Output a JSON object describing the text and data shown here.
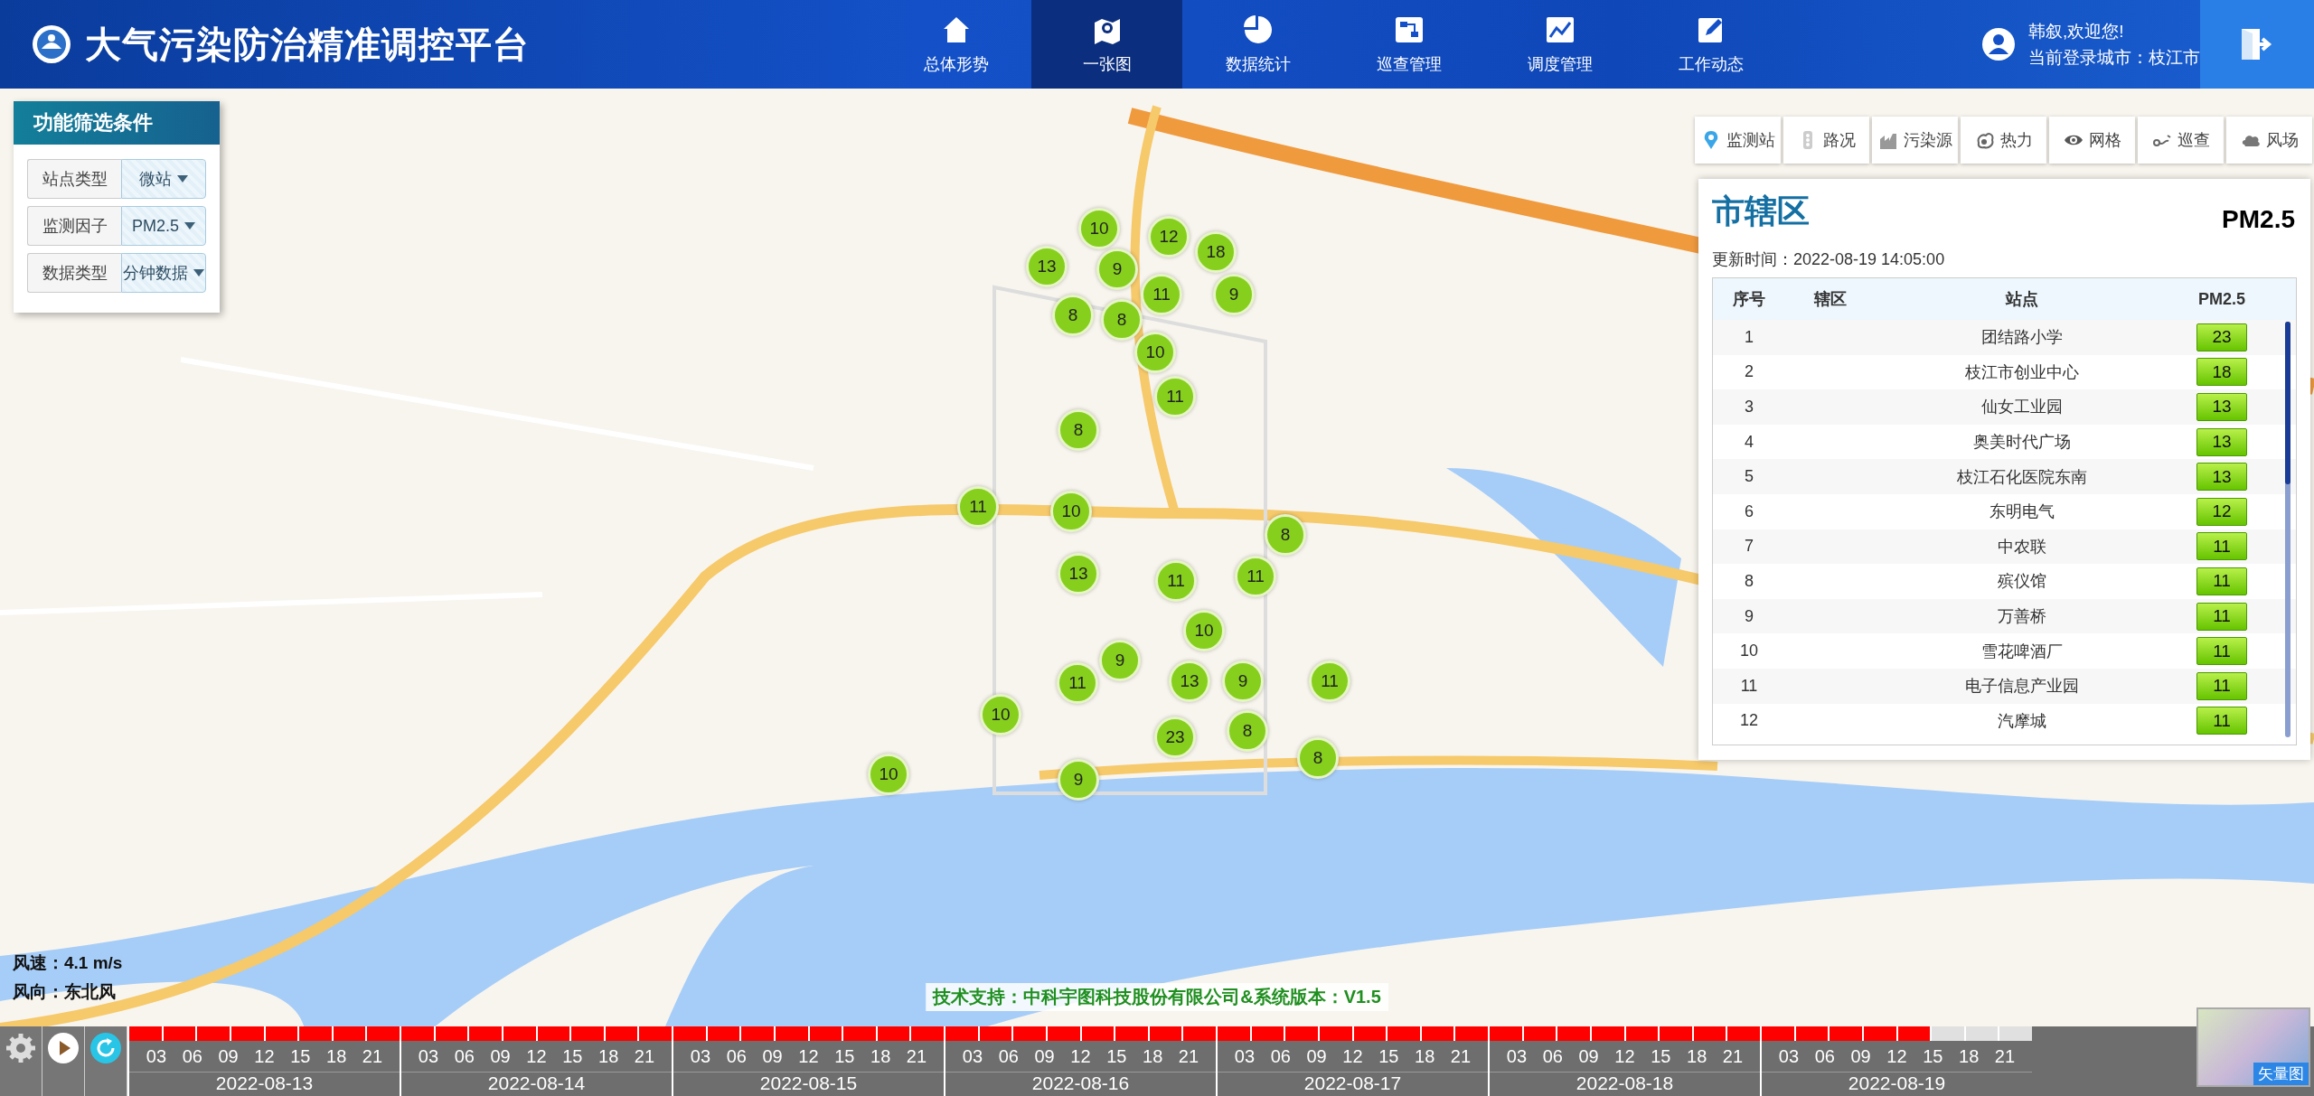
{
  "header": {
    "title": "大气污染防治精准调控平台",
    "nav": [
      {
        "label": "总体形势",
        "selected": false
      },
      {
        "label": "一张图",
        "selected": true
      },
      {
        "label": "数据统计",
        "selected": false
      },
      {
        "label": "巡查管理",
        "selected": false
      },
      {
        "label": "调度管理",
        "selected": false
      },
      {
        "label": "工作动态",
        "selected": false
      }
    ],
    "user": {
      "greeting": "韩叙,欢迎您!",
      "city": "当前登录城市：枝江市"
    }
  },
  "filters": {
    "title": "功能筛选条件",
    "rows": [
      {
        "label": "站点类型",
        "value": "微站"
      },
      {
        "label": "监测因子",
        "value": "PM2.5"
      },
      {
        "label": "数据类型",
        "value": "分钟数据"
      }
    ]
  },
  "layers": [
    {
      "label": "监测站"
    },
    {
      "label": "路况"
    },
    {
      "label": "污染源"
    },
    {
      "label": "热力"
    },
    {
      "label": "网格"
    },
    {
      "label": "巡查"
    },
    {
      "label": "风场"
    }
  ],
  "markers": [
    {
      "value": "10"
    },
    {
      "value": "12"
    },
    {
      "value": "18"
    },
    {
      "value": "13"
    },
    {
      "value": "9"
    },
    {
      "value": "11"
    },
    {
      "value": "9"
    },
    {
      "value": "8"
    },
    {
      "value": "8"
    },
    {
      "value": "10"
    },
    {
      "value": "11"
    },
    {
      "value": "8"
    },
    {
      "value": "11"
    },
    {
      "value": "10"
    },
    {
      "value": "8"
    },
    {
      "value": "13"
    },
    {
      "value": "11"
    },
    {
      "value": "11"
    },
    {
      "value": "10"
    },
    {
      "value": "9"
    },
    {
      "value": "11"
    },
    {
      "value": "13"
    },
    {
      "value": "9"
    },
    {
      "value": "11"
    },
    {
      "value": "10"
    },
    {
      "value": "23"
    },
    {
      "value": "8"
    },
    {
      "value": "10"
    },
    {
      "value": "8"
    },
    {
      "value": "9"
    }
  ],
  "panel": {
    "title": "市辖区",
    "pollutant": "PM2.5",
    "update_time": "更新时间：2022-08-19 14:05:00",
    "columns": [
      "序号",
      "辖区",
      "站点",
      "PM2.5"
    ],
    "rows": [
      {
        "index": "1",
        "station": "团结路小学",
        "value": "23"
      },
      {
        "index": "2",
        "station": "枝江市创业中心",
        "value": "18"
      },
      {
        "index": "3",
        "station": "仙女工业园",
        "value": "13"
      },
      {
        "index": "4",
        "station": "奥美时代广场",
        "value": "13"
      },
      {
        "index": "5",
        "station": "枝江石化医院东南",
        "value": "13"
      },
      {
        "index": "6",
        "station": "东明电气",
        "value": "12"
      },
      {
        "index": "7",
        "station": "中农联",
        "value": "11"
      },
      {
        "index": "8",
        "station": "殡仪馆",
        "value": "11"
      },
      {
        "index": "9",
        "station": "万善桥",
        "value": "11"
      },
      {
        "index": "10",
        "station": "雪花啤酒厂",
        "value": "11"
      },
      {
        "index": "11",
        "station": "电子信息产业园",
        "value": "11"
      },
      {
        "index": "12",
        "station": "汽摩城",
        "value": "11"
      }
    ]
  },
  "wind": {
    "speed": "风速：4.1 m/s",
    "direction": "风向：东北风"
  },
  "timeline": {
    "days": [
      {
        "date": "2022-08-13",
        "hours": [
          "03",
          "06",
          "09",
          "12",
          "15",
          "18",
          "21"
        ],
        "segments": [
          {
            "filled": true
          },
          {
            "filled": true
          },
          {
            "filled": true
          },
          {
            "filled": true
          },
          {
            "filled": true
          },
          {
            "filled": true
          },
          {
            "filled": true
          },
          {
            "filled": true
          }
        ]
      },
      {
        "date": "2022-08-14",
        "hours": [
          "03",
          "06",
          "09",
          "12",
          "15",
          "18",
          "21"
        ],
        "segments": [
          {
            "filled": true
          },
          {
            "filled": true
          },
          {
            "filled": true
          },
          {
            "filled": true
          },
          {
            "filled": true
          },
          {
            "filled": true
          },
          {
            "filled": true
          },
          {
            "filled": true
          }
        ]
      },
      {
        "date": "2022-08-15",
        "hours": [
          "03",
          "06",
          "09",
          "12",
          "15",
          "18",
          "21"
        ],
        "segments": [
          {
            "filled": true
          },
          {
            "filled": true
          },
          {
            "filled": true
          },
          {
            "filled": true
          },
          {
            "filled": true
          },
          {
            "filled": true
          },
          {
            "filled": true
          },
          {
            "filled": true
          }
        ]
      },
      {
        "date": "2022-08-16",
        "hours": [
          "03",
          "06",
          "09",
          "12",
          "15",
          "18",
          "21"
        ],
        "segments": [
          {
            "filled": true
          },
          {
            "filled": true
          },
          {
            "filled": true
          },
          {
            "filled": true
          },
          {
            "filled": true
          },
          {
            "filled": true
          },
          {
            "filled": true
          },
          {
            "filled": true
          }
        ]
      },
      {
        "date": "2022-08-17",
        "hours": [
          "03",
          "06",
          "09",
          "12",
          "15",
          "18",
          "21"
        ],
        "segments": [
          {
            "filled": true
          },
          {
            "filled": true
          },
          {
            "filled": true
          },
          {
            "filled": true
          },
          {
            "filled": true
          },
          {
            "filled": true
          },
          {
            "filled": true
          },
          {
            "filled": true
          }
        ]
      },
      {
        "date": "2022-08-18",
        "hours": [
          "03",
          "06",
          "09",
          "12",
          "15",
          "18",
          "21"
        ],
        "segments": [
          {
            "filled": true
          },
          {
            "filled": true
          },
          {
            "filled": true
          },
          {
            "filled": true
          },
          {
            "filled": true
          },
          {
            "filled": true
          },
          {
            "filled": true
          },
          {
            "filled": true
          }
        ]
      },
      {
        "date": "2022-08-19",
        "hours": [
          "03",
          "06",
          "09",
          "12",
          "15",
          "18",
          "21"
        ],
        "segments": [
          {
            "filled": true
          },
          {
            "filled": true
          },
          {
            "filled": true
          },
          {
            "filled": true
          },
          {
            "filled": true
          },
          {
            "filled": false
          },
          {
            "filled": false
          },
          {
            "filled": false
          }
        ]
      }
    ]
  },
  "footer": "技术支持：中科宇图科技股份有限公司&系统版本：V1.5",
  "minimap": {
    "label": "矢量图"
  }
}
